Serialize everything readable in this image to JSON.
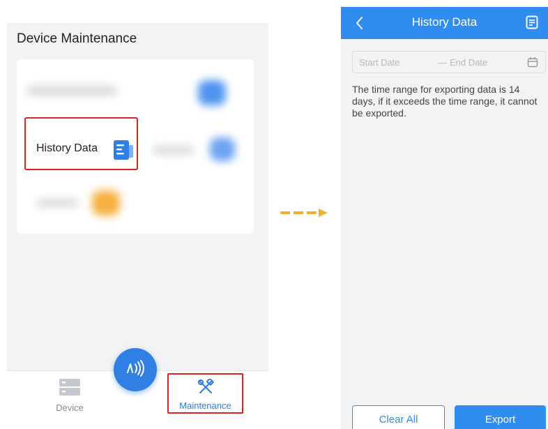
{
  "left": {
    "title": "Device Maintenance",
    "history_item": {
      "label": "History Data",
      "icon": "document-icon"
    },
    "tabs": [
      {
        "label": "Device",
        "icon": "server-icon",
        "active": false
      },
      {
        "label": "Maintenance",
        "icon": "tools-icon",
        "active": true
      }
    ],
    "nfc_icon": "nfc-icon"
  },
  "arrow_icon": "dashed-arrow-icon",
  "right": {
    "header": {
      "title": "History Data",
      "back_icon": "chevron-left-icon",
      "action_icon": "document-icon"
    },
    "date_range": {
      "start_placeholder": "Start Date",
      "separator": "—",
      "end_placeholder": "End Date",
      "icon": "calendar-icon"
    },
    "note": "The time range for exporting data is 14 days, if it exceeds the time range, it cannot be exported.",
    "buttons": {
      "clear": "Clear All",
      "export": "Export"
    }
  },
  "colors": {
    "primary": "#2f8cf0",
    "highlight": "#e02020",
    "arrow": "#f0b030",
    "background": "#f2f3f5"
  }
}
